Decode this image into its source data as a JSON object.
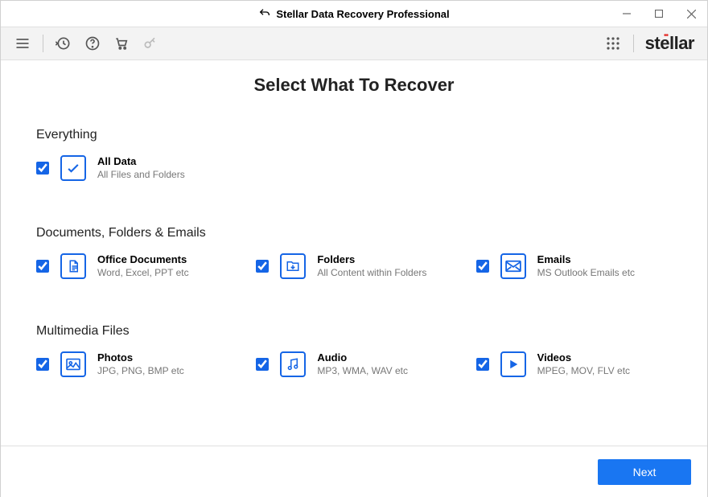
{
  "window": {
    "title": "Stellar Data Recovery Professional",
    "brand": "stellar"
  },
  "heading": "Select What To Recover",
  "sections": {
    "everything": {
      "title": "Everything",
      "all": {
        "label": "All Data",
        "sub": "All Files and Folders"
      }
    },
    "docs": {
      "title": "Documents, Folders & Emails",
      "office": {
        "label": "Office Documents",
        "sub": "Word, Excel, PPT etc"
      },
      "folders": {
        "label": "Folders",
        "sub": "All Content within Folders"
      },
      "emails": {
        "label": "Emails",
        "sub": "MS Outlook Emails etc"
      }
    },
    "media": {
      "title": "Multimedia Files",
      "photos": {
        "label": "Photos",
        "sub": "JPG, PNG, BMP etc"
      },
      "audio": {
        "label": "Audio",
        "sub": "MP3, WMA, WAV etc"
      },
      "videos": {
        "label": "Videos",
        "sub": "MPEG, MOV, FLV etc"
      }
    }
  },
  "footer": {
    "next": "Next"
  }
}
